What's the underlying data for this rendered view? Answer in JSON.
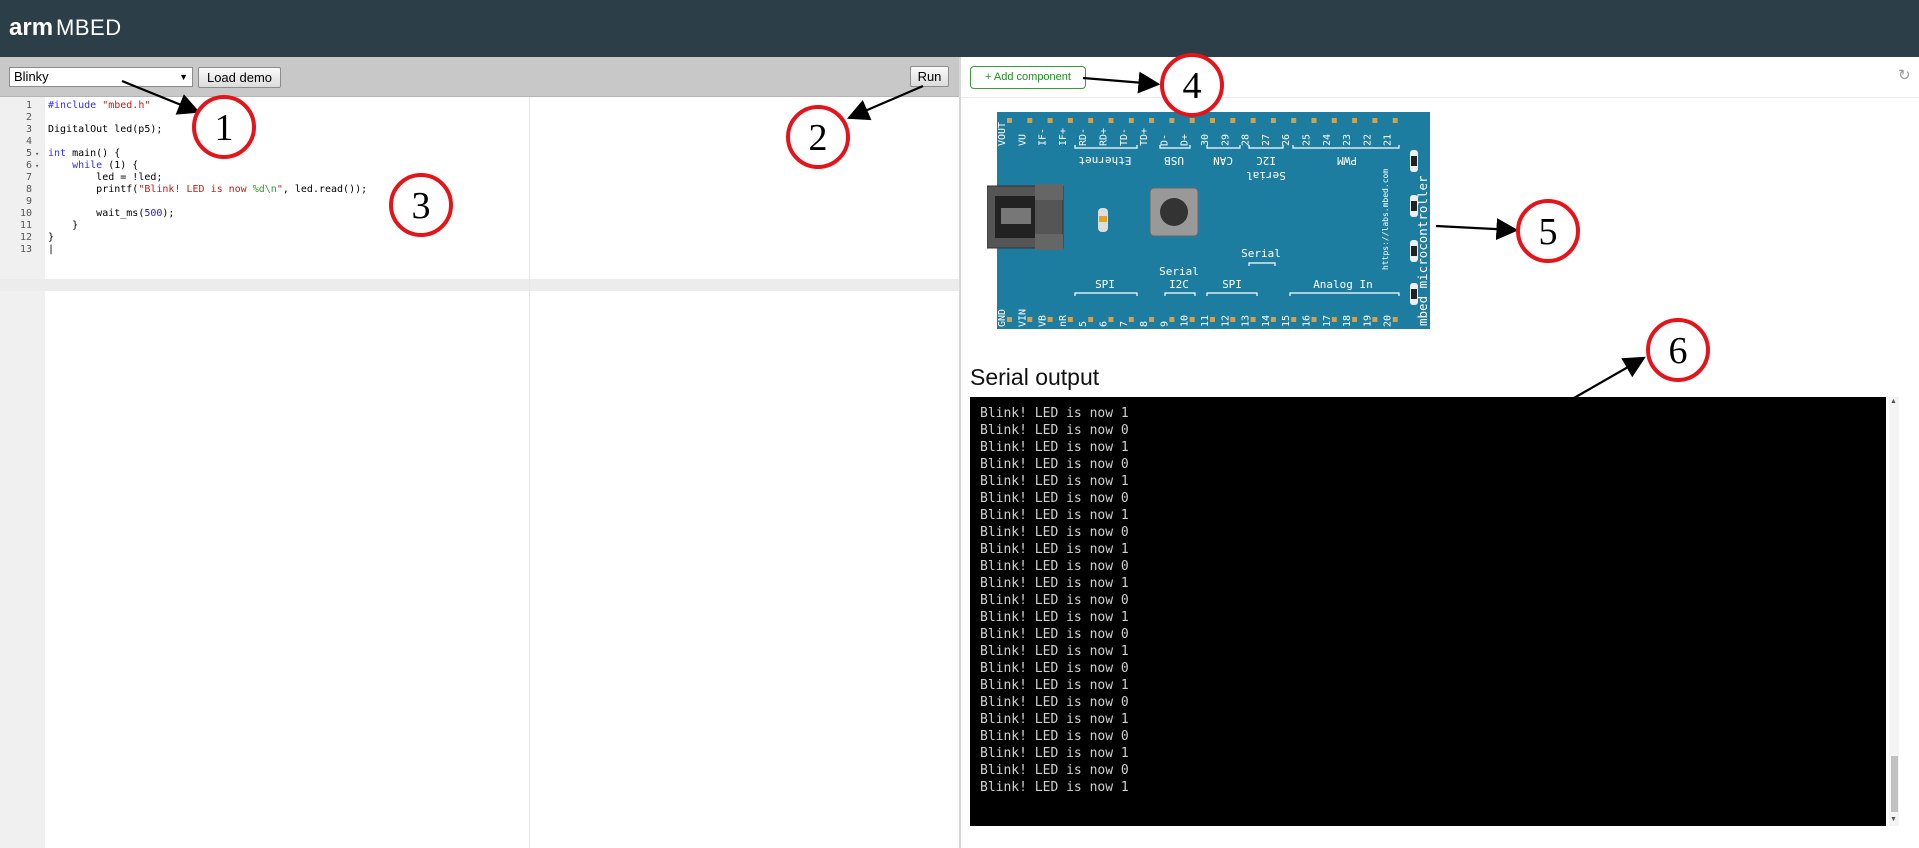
{
  "header": {
    "logo_arm": "arm",
    "logo_mbed": "MBED"
  },
  "toolbar": {
    "demo_select_value": "Blinky",
    "load_label": "Load demo",
    "run_label": "Run"
  },
  "editor": {
    "lines": [
      {
        "n": "1",
        "fold": ""
      },
      {
        "n": "2",
        "fold": ""
      },
      {
        "n": "3",
        "fold": ""
      },
      {
        "n": "4",
        "fold": ""
      },
      {
        "n": "5",
        "fold": "▾"
      },
      {
        "n": "6",
        "fold": "▾"
      },
      {
        "n": "7",
        "fold": ""
      },
      {
        "n": "8",
        "fold": ""
      },
      {
        "n": "9",
        "fold": ""
      },
      {
        "n": "10",
        "fold": ""
      },
      {
        "n": "11",
        "fold": ""
      },
      {
        "n": "12",
        "fold": ""
      },
      {
        "n": "13",
        "fold": ""
      }
    ],
    "tokens": {
      "include_kw": "#include",
      "include_str": "\"mbed.h\"",
      "l3": "DigitalOut led(p5);",
      "int_kw": "int",
      "main_sig": " main() {",
      "while_kw": "while",
      "while_rest": " (1) {",
      "l7": "led = !led;",
      "printf_start": "printf(",
      "str_a": "\"Blink! LED is now ",
      "str_fmt": "%d\\n",
      "str_b": "\"",
      "printf_end": ", led.read());",
      "wait_start": "wait_ms(",
      "wait_num": "500",
      "wait_end": ");",
      "l11": "}",
      "l12": "}"
    }
  },
  "right": {
    "add_component_label": "+ Add component",
    "refresh_icon": "↻"
  },
  "board": {
    "top_pins": [
      "VOUT",
      "VU",
      "IF-",
      "IF+",
      "RD-",
      "RD+",
      "TD-",
      "TD+",
      "D-",
      "D+",
      "30",
      "29",
      "28",
      "27",
      "26",
      "25",
      "24",
      "23",
      "22",
      "21"
    ],
    "bottom_pins": [
      "GND",
      "VIN",
      "VB",
      "nR",
      "5",
      "6",
      "7",
      "8",
      "9",
      "10",
      "11",
      "12",
      "13",
      "14",
      "15",
      "16",
      "17",
      "18",
      "19",
      "20"
    ],
    "top_groups": [
      "Ethernet",
      "USB",
      "CAN",
      "I2C",
      "PWM"
    ],
    "top_serial": "Serial",
    "bottom_groups": [
      "SPI",
      "I2C",
      "SPI",
      "Analog In"
    ],
    "bottom_serial_1": "Serial",
    "bottom_serial_2": "Serial",
    "side_text": "mbed microcontroller",
    "url": "https://labs.mbed.com",
    "color": "#1d7da0"
  },
  "serial": {
    "title": "Serial output",
    "lines": [
      "Blink! LED is now 1",
      "Blink! LED is now 0",
      "Blink! LED is now 1",
      "Blink! LED is now 0",
      "Blink! LED is now 1",
      "Blink! LED is now 0",
      "Blink! LED is now 1",
      "Blink! LED is now 0",
      "Blink! LED is now 1",
      "Blink! LED is now 0",
      "Blink! LED is now 1",
      "Blink! LED is now 0",
      "Blink! LED is now 1",
      "Blink! LED is now 0",
      "Blink! LED is now 1",
      "Blink! LED is now 0",
      "Blink! LED is now 1",
      "Blink! LED is now 0",
      "Blink! LED is now 1",
      "Blink! LED is now 0",
      "Blink! LED is now 1",
      "Blink! LED is now 0",
      "Blink! LED is now 1"
    ]
  },
  "callouts": [
    "1",
    "2",
    "3",
    "4",
    "5",
    "6"
  ]
}
